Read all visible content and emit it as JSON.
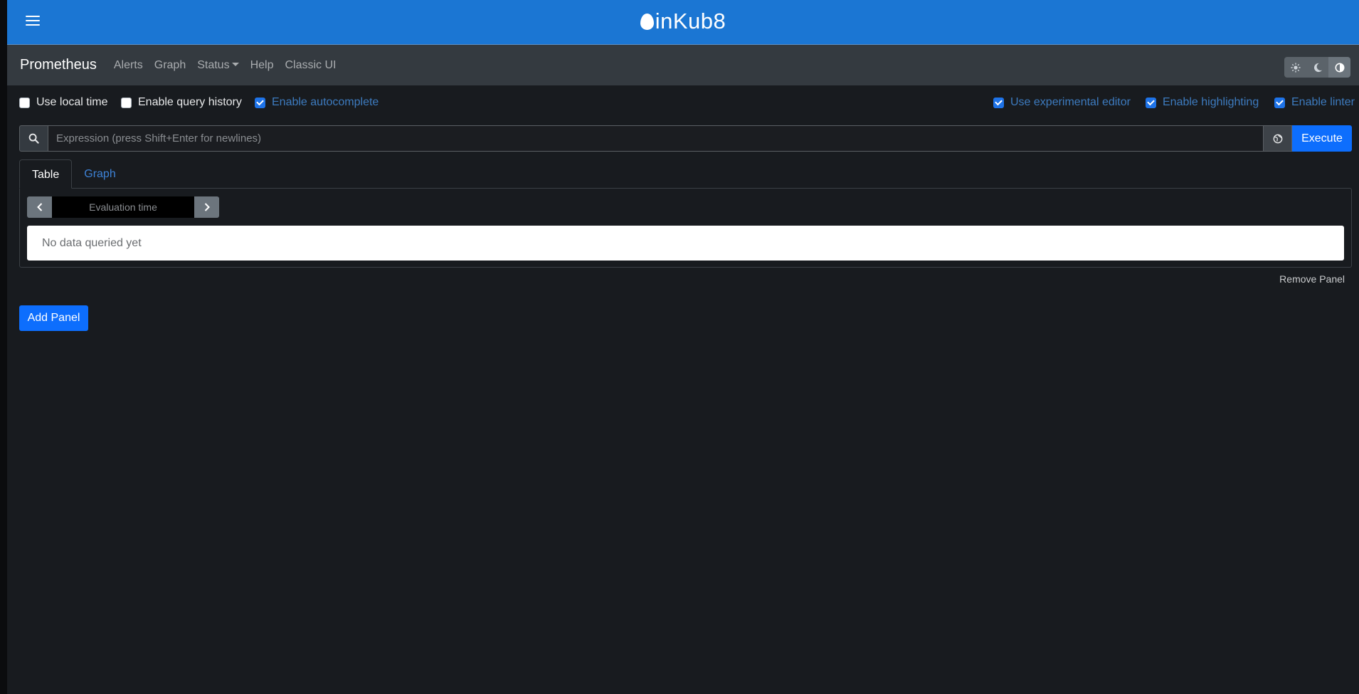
{
  "header": {
    "brand": "inKub8"
  },
  "navbar": {
    "title": "Prometheus",
    "links": [
      "Alerts",
      "Graph",
      "Status",
      "Help",
      "Classic UI"
    ]
  },
  "options": {
    "use_local_time": {
      "label": "Use local time",
      "checked": false
    },
    "enable_query_history": {
      "label": "Enable query history",
      "checked": false
    },
    "enable_autocomplete": {
      "label": "Enable autocomplete",
      "checked": true
    },
    "use_experimental_editor": {
      "label": "Use experimental editor",
      "checked": true
    },
    "enable_highlighting": {
      "label": "Enable highlighting",
      "checked": true
    },
    "enable_linter": {
      "label": "Enable linter",
      "checked": true
    }
  },
  "expression": {
    "placeholder": "Expression (press Shift+Enter for newlines)",
    "value": "",
    "execute_label": "Execute"
  },
  "panel": {
    "tabs": [
      "Table",
      "Graph"
    ],
    "active_tab": "Table",
    "evaluation_time_placeholder": "Evaluation time",
    "no_data_text": "No data queried yet",
    "remove_label": "Remove Panel"
  },
  "add_panel_label": "Add Panel",
  "colors": {
    "header_blue": "#1b76d3",
    "navbar": "#343a40",
    "background": "#181b1f",
    "primary": "#0d6efd"
  }
}
